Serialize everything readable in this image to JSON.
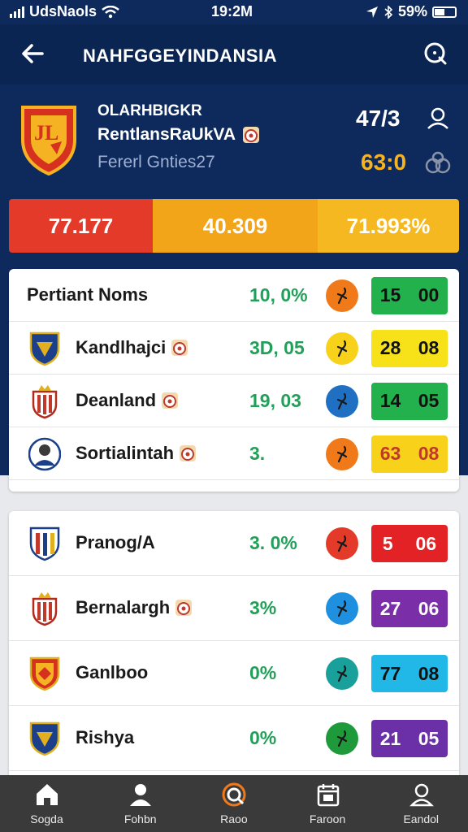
{
  "status_bar": {
    "carrier": "UdsNaols",
    "time": "19:2M",
    "battery": "59%"
  },
  "header": {
    "title": "NAHFGGEYINDANSIA"
  },
  "team": {
    "line1": "OLARHBIGKR",
    "line2": "RentlansRaUkVA",
    "line3": "Fererl Gnties27",
    "score1": "47/3",
    "score2": "63:0"
  },
  "stats": [
    "77.177",
    "40.309",
    "71.993%"
  ],
  "colors": {
    "navy": "#0e2a5c",
    "red": "#e33a2a",
    "orange": "#f3a51a",
    "green": "#22b14c",
    "yellow": "#f7d11a",
    "purple": "#7a2fa8",
    "cyan": "#21b7e6"
  },
  "table1": {
    "rows": [
      {
        "name": "Pertiant Noms",
        "pct": "10, 0%",
        "pct_color": "#22a05a",
        "circle": "#f07a1a",
        "score_a": "15",
        "score_b": "00",
        "box": "#22b14c",
        "box_text": "#111111",
        "logo": "none"
      },
      {
        "name": "Kandlhajci",
        "pct": "3D, 05",
        "pct_color": "#22a05a",
        "circle": "#f7d11a",
        "score_a": "28",
        "score_b": "08",
        "box": "#f7e21a",
        "box_text": "#111111",
        "logo": "blue-shield"
      },
      {
        "name": "Deanland",
        "pct": "19, 03",
        "pct_color": "#22a05a",
        "circle": "#1f6fc2",
        "score_a": "14",
        "score_b": "05",
        "box": "#22b14c",
        "box_text": "#111111",
        "logo": "red-crest"
      },
      {
        "name": "Sortialintah",
        "pct": "3.",
        "pct_color": "#22a05a",
        "circle": "#f07a1a",
        "score_a": "63",
        "score_b": "08",
        "box": "#f7d11a",
        "box_text": "#c0392b",
        "logo": "portrait"
      }
    ]
  },
  "table2": {
    "rows": [
      {
        "name": "Pranog/A",
        "pct": "3. 0%",
        "pct_color": "#22a05a",
        "circle": "#e33a2a",
        "score_a": "5",
        "score_b": "06",
        "box": "#e32226",
        "box_text": "#ffffff",
        "logo": "stripe-shield"
      },
      {
        "name": "Bernalargh",
        "pct": "3%",
        "pct_color": "#22a05a",
        "circle": "#1f8fe0",
        "score_a": "27",
        "score_b": "06",
        "box": "#7a2fa8",
        "box_text": "#ffffff",
        "logo": "red-crest"
      },
      {
        "name": "Ganlboo",
        "pct": "0%",
        "pct_color": "#22a05a",
        "circle": "#1aa09a",
        "score_a": "77",
        "score_b": "08",
        "box": "#21b7e6",
        "box_text": "#111111",
        "logo": "ju-crest"
      },
      {
        "name": "Rishya",
        "pct": "0%",
        "pct_color": "#22a05a",
        "circle": "#1f9a3a",
        "score_a": "21",
        "score_b": "05",
        "box": "#6b2fa8",
        "box_text": "#ffffff",
        "logo": "blue-shield"
      }
    ]
  },
  "nav": [
    "Sogda",
    "Fohbn",
    "Raoo",
    "Faroon",
    "Eandol"
  ]
}
